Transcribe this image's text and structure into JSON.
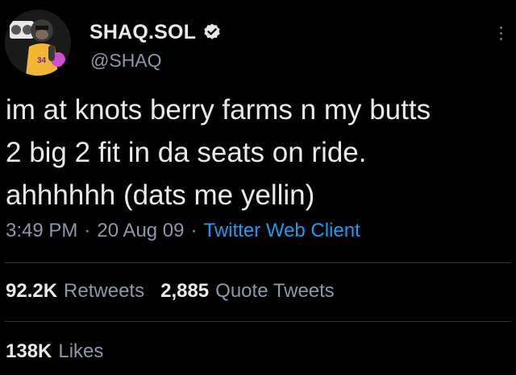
{
  "author": {
    "display_name": "SHAQ.SOL",
    "handle": "@SHAQ",
    "verified": true
  },
  "tweet": {
    "text": "im at knots berry farms n my butts\n2 big 2 fit in da seats on ride.\nahhhhhh (dats me yellin)"
  },
  "meta": {
    "time": "3:49 PM",
    "separator": "·",
    "date": "20 Aug 09",
    "source": "Twitter Web Client"
  },
  "stats": {
    "retweets_count": "92.2K",
    "retweets_label": "Retweets",
    "quote_count": "2,885",
    "quote_label": "Quote Tweets",
    "likes_count": "138K",
    "likes_label": "Likes"
  },
  "colors": {
    "background": "#000000",
    "primary_text": "#e7e9ea",
    "secondary_text": "#8b98a5",
    "link": "#1d9bf0",
    "divider": "#2f3336"
  },
  "icons": {
    "verified": "verified-badge-icon",
    "more": "more-options-icon"
  }
}
